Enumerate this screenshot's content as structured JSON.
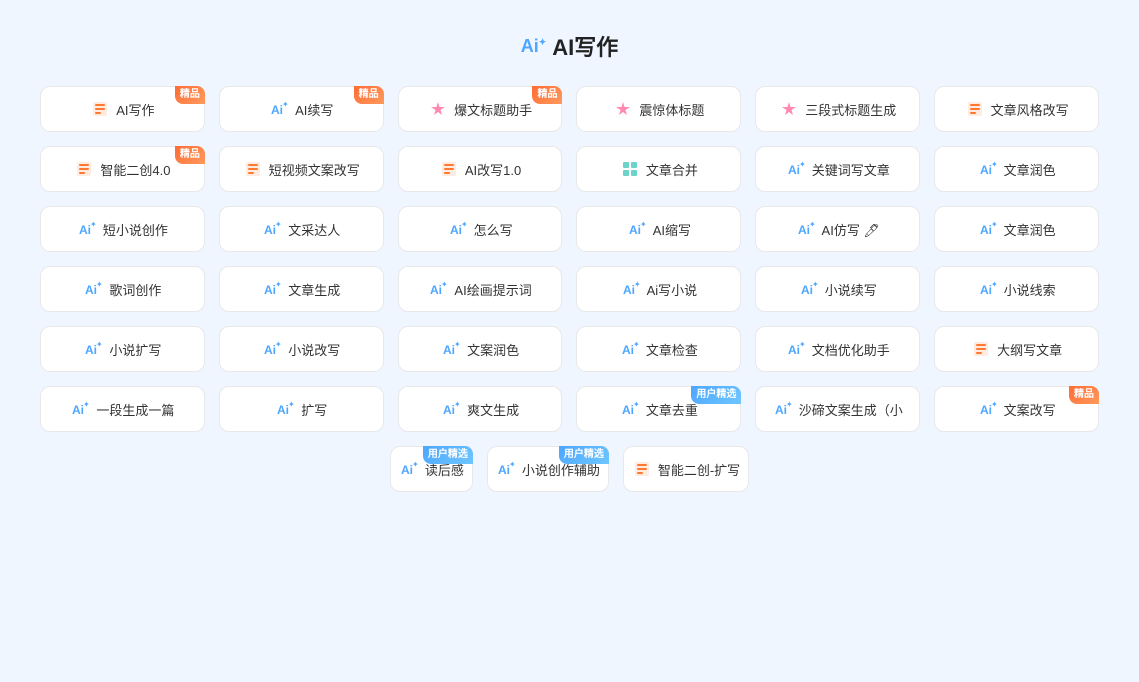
{
  "page": {
    "title": "AI写作",
    "title_prefix": "Ai"
  },
  "rows": [
    {
      "id": "row1",
      "items": [
        {
          "id": "ai-write",
          "icon": "✍",
          "icon_color": "icon-orange",
          "label": "AI写作",
          "badge": "精品",
          "badge_type": "jingpin"
        },
        {
          "id": "ai-continue",
          "icon": "📝",
          "icon_color": "icon-blue",
          "label": "AI续写",
          "badge": "精品",
          "badge_type": "jingpin"
        },
        {
          "id": "headline-helper",
          "icon": "🔥",
          "icon_color": "icon-pink",
          "label": "爆文标题助手",
          "badge": "精品",
          "badge_type": "jingpin"
        },
        {
          "id": "shocking-title",
          "icon": "🏷",
          "icon_color": "icon-pink",
          "label": "震惊体标题",
          "badge": "",
          "badge_type": ""
        },
        {
          "id": "three-para-title",
          "icon": "🏷",
          "icon_color": "icon-pink",
          "label": "三段式标题生成",
          "badge": "",
          "badge_type": ""
        },
        {
          "id": "article-style",
          "icon": "📄",
          "icon_color": "icon-orange",
          "label": "文章风格改写",
          "badge": "",
          "badge_type": ""
        }
      ]
    },
    {
      "id": "row2",
      "items": [
        {
          "id": "smart-recreate",
          "icon": "📄",
          "icon_color": "icon-orange",
          "label": "智能二创4.0",
          "badge": "精品",
          "badge_type": "jingpin"
        },
        {
          "id": "short-video-copy",
          "icon": "📄",
          "icon_color": "icon-orange",
          "label": "短视频文案改写",
          "badge": "",
          "badge_type": ""
        },
        {
          "id": "ai-rewrite",
          "icon": "📄",
          "icon_color": "icon-orange",
          "label": "AI改写1.0",
          "badge": "",
          "badge_type": ""
        },
        {
          "id": "article-merge",
          "icon": "⊞",
          "icon_color": "icon-teal",
          "label": "文章合并",
          "badge": "",
          "badge_type": ""
        },
        {
          "id": "keyword-article",
          "icon": "✦",
          "icon_color": "icon-blue",
          "label": "关键词写文章",
          "badge": "",
          "badge_type": ""
        },
        {
          "id": "article-polish1",
          "icon": "✦",
          "icon_color": "icon-blue",
          "label": "文章润色",
          "badge": "",
          "badge_type": ""
        }
      ]
    },
    {
      "id": "row3",
      "items": [
        {
          "id": "short-novel",
          "icon": "✦",
          "icon_color": "icon-blue",
          "label": "短小说创作",
          "badge": "",
          "badge_type": ""
        },
        {
          "id": "writing-talent",
          "icon": "✦",
          "icon_color": "icon-blue",
          "label": "文采达人",
          "badge": "",
          "badge_type": ""
        },
        {
          "id": "how-to-write",
          "icon": "✦",
          "icon_color": "icon-blue",
          "label": "怎么写",
          "badge": "",
          "badge_type": ""
        },
        {
          "id": "ai-compress",
          "icon": "✦",
          "icon_color": "icon-blue",
          "label": "AI缩写",
          "badge": "",
          "badge_type": ""
        },
        {
          "id": "ai-imitate",
          "icon": "✦",
          "icon_color": "icon-blue",
          "label": "AI仿写 🖊",
          "badge": "",
          "badge_type": ""
        },
        {
          "id": "article-polish2",
          "icon": "✦",
          "icon_color": "icon-blue",
          "label": "文章润色",
          "badge": "",
          "badge_type": ""
        }
      ]
    },
    {
      "id": "row4",
      "items": [
        {
          "id": "lyrics",
          "icon": "✦",
          "icon_color": "icon-blue",
          "label": "歌词创作",
          "badge": "",
          "badge_type": ""
        },
        {
          "id": "article-generate",
          "icon": "✦",
          "icon_color": "icon-blue",
          "label": "文章生成",
          "badge": "",
          "badge_type": ""
        },
        {
          "id": "ai-draw-prompt",
          "icon": "✦",
          "icon_color": "icon-blue",
          "label": "AI绘画提示词",
          "badge": "",
          "badge_type": ""
        },
        {
          "id": "ai-write-novel",
          "icon": "✦",
          "icon_color": "icon-blue",
          "label": "Ai写小说",
          "badge": "",
          "badge_type": ""
        },
        {
          "id": "novel-continue",
          "icon": "✦",
          "icon_color": "icon-blue",
          "label": "小说续写",
          "badge": "",
          "badge_type": ""
        },
        {
          "id": "novel-clue",
          "icon": "✦",
          "icon_color": "icon-blue",
          "label": "小说线索",
          "badge": "",
          "badge_type": ""
        }
      ]
    },
    {
      "id": "row5",
      "items": [
        {
          "id": "novel-expand",
          "icon": "✦",
          "icon_color": "icon-blue",
          "label": "小说扩写",
          "badge": "",
          "badge_type": ""
        },
        {
          "id": "novel-rewrite",
          "icon": "✦",
          "icon_color": "icon-blue",
          "label": "小说改写",
          "badge": "",
          "badge_type": ""
        },
        {
          "id": "copy-polish",
          "icon": "✦",
          "icon_color": "icon-blue",
          "label": "文案润色",
          "badge": "",
          "badge_type": ""
        },
        {
          "id": "article-check",
          "icon": "✦",
          "icon_color": "icon-blue",
          "label": "文章检查",
          "badge": "",
          "badge_type": ""
        },
        {
          "id": "doc-optimize",
          "icon": "✦",
          "icon_color": "icon-blue",
          "label": "文档优化助手",
          "badge": "",
          "badge_type": ""
        },
        {
          "id": "outline-article",
          "icon": "📄",
          "icon_color": "icon-orange",
          "label": "大纲写文章",
          "badge": "",
          "badge_type": ""
        }
      ]
    },
    {
      "id": "row6",
      "items": [
        {
          "id": "one-para",
          "icon": "✦",
          "icon_color": "icon-blue",
          "label": "一段生成一篇",
          "badge": "",
          "badge_type": ""
        },
        {
          "id": "expand",
          "icon": "✦",
          "icon_color": "icon-blue",
          "label": "扩写",
          "badge": "",
          "badge_type": ""
        },
        {
          "id": "fun-generate",
          "icon": "✦",
          "icon_color": "icon-blue",
          "label": "爽文生成",
          "badge": "",
          "badge_type": ""
        },
        {
          "id": "article-dedup",
          "icon": "✦",
          "icon_color": "icon-blue",
          "label": "文章去重",
          "badge": "用户精选",
          "badge_type": "user"
        },
        {
          "id": "sha-di-copy",
          "icon": "✦",
          "icon_color": "icon-blue",
          "label": "沙碲文案生成（小",
          "badge": "",
          "badge_type": ""
        },
        {
          "id": "copy-rewrite",
          "icon": "✦",
          "icon_color": "icon-blue",
          "label": "文案改写",
          "badge": "精品",
          "badge_type": "jingpin"
        }
      ]
    },
    {
      "id": "row7",
      "items": [
        {
          "id": "reading-notes",
          "icon": "✦",
          "icon_color": "icon-blue",
          "label": "读后感",
          "badge": "用户精选",
          "badge_type": "user"
        },
        {
          "id": "novel-assist",
          "icon": "✦",
          "icon_color": "icon-blue",
          "label": "小说创作辅助",
          "badge": "用户精选",
          "badge_type": "user"
        },
        {
          "id": "smart-recreate2",
          "icon": "📄",
          "icon_color": "icon-orange",
          "label": "智能二创-扩写",
          "badge": "",
          "badge_type": ""
        }
      ]
    }
  ]
}
